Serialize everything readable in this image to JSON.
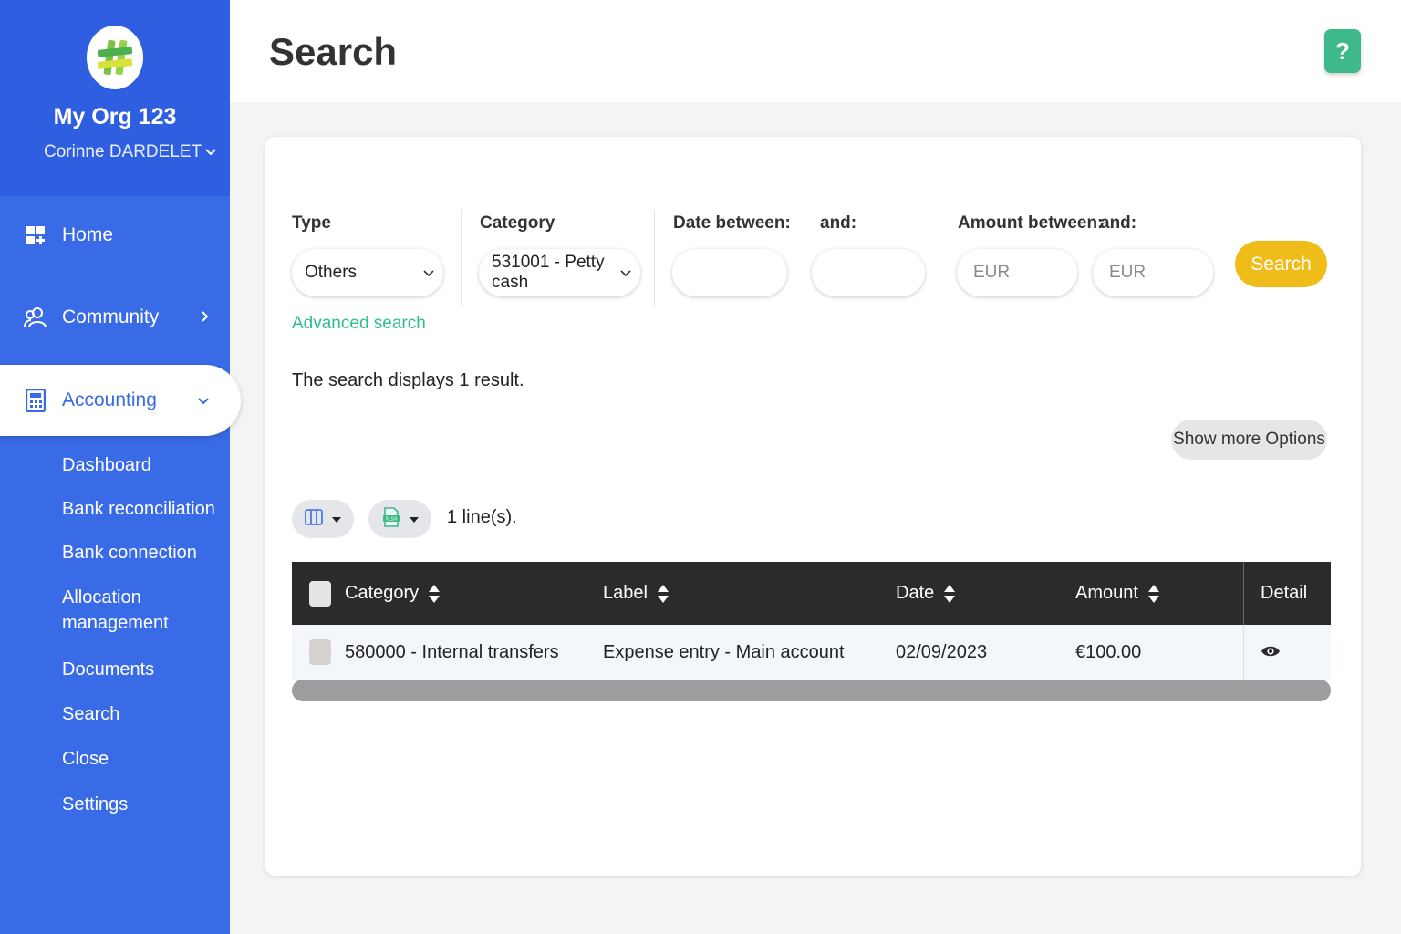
{
  "sidebar": {
    "org_name": "My Org 123",
    "user_name": "Corinne DARDELET",
    "nav": {
      "home": "Home",
      "community": "Community",
      "accounting": "Accounting"
    },
    "sub_items": [
      "Dashboard",
      "Bank reconciliation",
      "Bank connection",
      "Allocation management",
      "Documents",
      "Search",
      "Close",
      "Settings"
    ]
  },
  "header": {
    "title": "Search",
    "help_label": "?"
  },
  "filters": {
    "type_label": "Type",
    "type_value": "Others",
    "category_label": "Category",
    "category_value": "531001 - Petty cash",
    "date_between_label": "Date between:",
    "date_and_label": "and:",
    "amount_between_label": "Amount between:",
    "amount_and_label": "and:",
    "amount_min_placeholder": "EUR",
    "amount_max_placeholder": "EUR",
    "search_button": "Search",
    "advanced_search": "Advanced search"
  },
  "results": {
    "summary": "The search displays 1 result.",
    "show_more_options": "Show more Options",
    "lines_count": "1 line(s).",
    "export_badge": "XLSX"
  },
  "table": {
    "headers": {
      "category": "Category",
      "label": "Label",
      "date": "Date",
      "amount": "Amount",
      "detail": "Detail"
    },
    "rows": [
      {
        "category": "580000 - Internal transfers",
        "label": "Expense entry - Main account",
        "date": "02/09/2023",
        "amount": "€100.00"
      }
    ]
  },
  "colors": {
    "sidebar": "#3a6be6",
    "accent_green": "#2fbf8b",
    "search_yellow": "#f0bc1a",
    "table_header": "#2b2b2b"
  }
}
